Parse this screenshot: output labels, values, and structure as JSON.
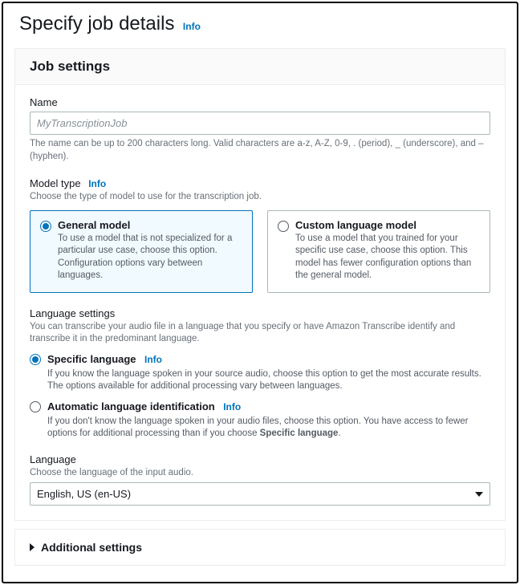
{
  "header": {
    "title": "Specify job details",
    "info": "Info"
  },
  "jobSettings": {
    "panelTitle": "Job settings",
    "name": {
      "label": "Name",
      "placeholder": "MyTranscriptionJob",
      "hint": "The name can be up to 200 characters long. Valid characters are a-z, A-Z, 0-9, . (period), _ (underscore), and – (hyphen)."
    },
    "modelType": {
      "label": "Model type",
      "info": "Info",
      "hint": "Choose the type of model to use for the transcription job.",
      "options": {
        "general": {
          "title": "General model",
          "desc": "To use a model that is not specialized for a particular use case, choose this option. Configuration options vary between languages."
        },
        "custom": {
          "title": "Custom language model",
          "desc": "To use a model that you trained for your specific use case, choose this option. This model has fewer configuration options than the general model."
        }
      }
    },
    "languageSettings": {
      "label": "Language settings",
      "hint": "You can transcribe your audio file in a language that you specify or have Amazon Transcribe identify and transcribe it in the predominant language.",
      "specific": {
        "title": "Specific language",
        "info": "Info",
        "desc": "If you know the language spoken in your source audio, choose this option to get the most accurate results. The options available for additional processing vary between languages."
      },
      "auto": {
        "title": "Automatic language identification",
        "info": "Info",
        "descPrefix": "If you don't know the language spoken in your audio files, choose this option. You have access to fewer options for additional processing than if you choose ",
        "descBold": "Specific language",
        "descSuffix": "."
      }
    },
    "language": {
      "label": "Language",
      "hint": "Choose the language of the input audio.",
      "value": "English, US (en-US)"
    }
  },
  "additional": {
    "title": "Additional settings"
  }
}
